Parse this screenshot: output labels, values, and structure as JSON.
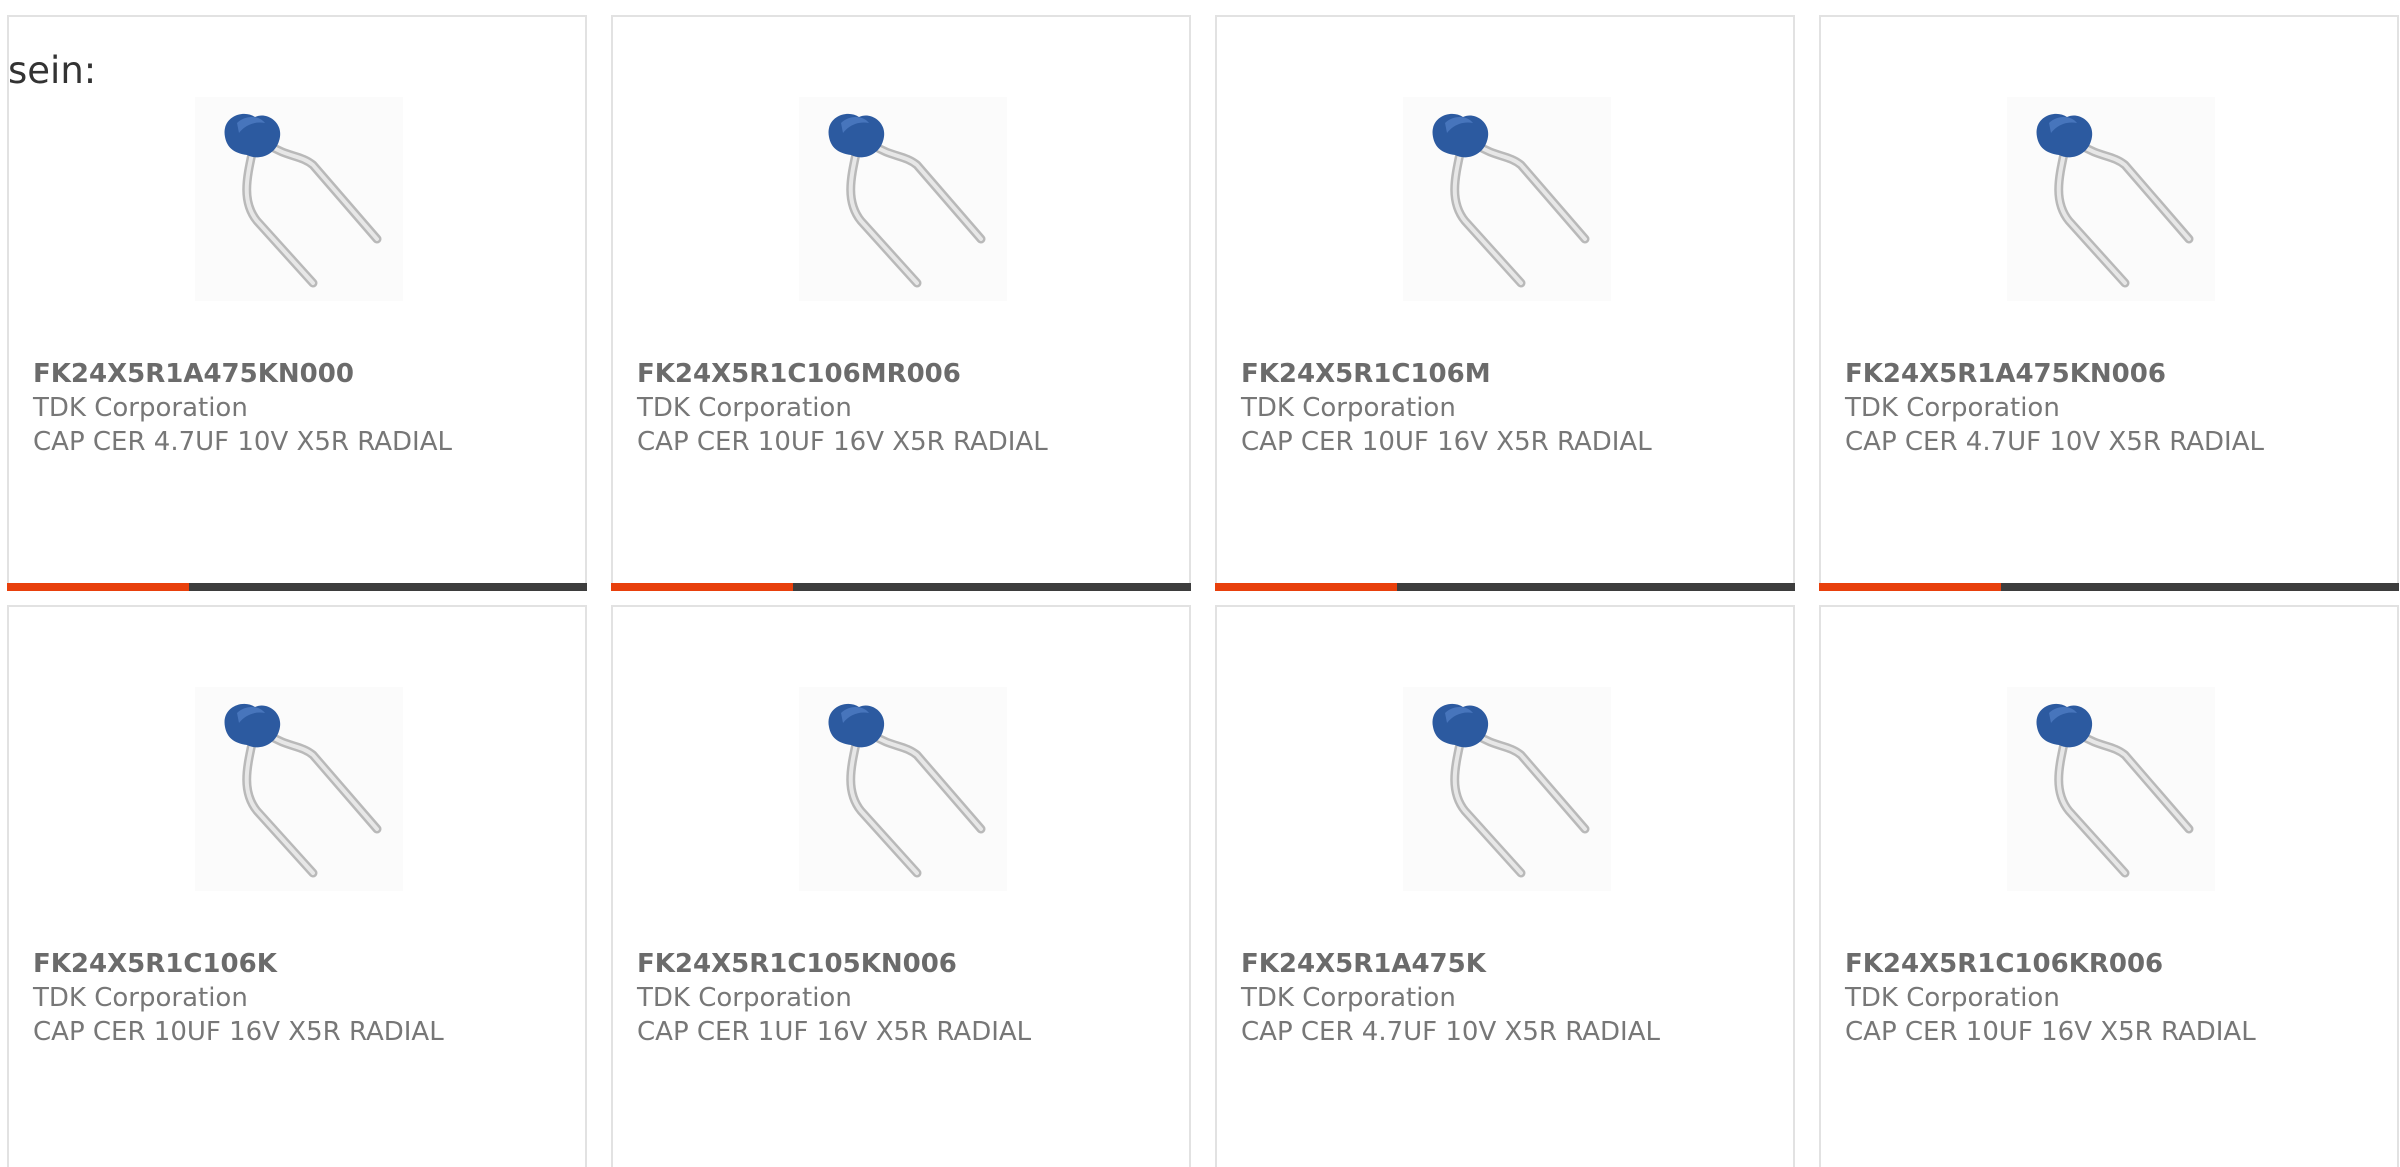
{
  "intro": {
    "text": "sein:"
  },
  "colors": {
    "accent": "#e8400c",
    "bar_dark": "#3d3d3d",
    "capacitor_blue": "#2c5aa0"
  },
  "products": [
    {
      "part_number": "FK24X5R1A475KN000",
      "manufacturer": "TDK Corporation",
      "description": "CAP CER 4.7UF 10V X5R RADIAL",
      "icon": "capacitor-image",
      "accent_bar": true
    },
    {
      "part_number": "FK24X5R1C106MR006",
      "manufacturer": "TDK Corporation",
      "description": "CAP CER 10UF 16V X5R RADIAL",
      "icon": "capacitor-image",
      "accent_bar": true
    },
    {
      "part_number": "FK24X5R1C106M",
      "manufacturer": "TDK Corporation",
      "description": "CAP CER 10UF 16V X5R RADIAL",
      "icon": "capacitor-image",
      "accent_bar": true
    },
    {
      "part_number": "FK24X5R1A475KN006",
      "manufacturer": "TDK Corporation",
      "description": "CAP CER 4.7UF 10V X5R RADIAL",
      "icon": "capacitor-image",
      "accent_bar": true
    },
    {
      "part_number": "FK24X5R1C106K",
      "manufacturer": "TDK Corporation",
      "description": "CAP CER 10UF 16V X5R RADIAL",
      "icon": "capacitor-image",
      "accent_bar": false
    },
    {
      "part_number": "FK24X5R1C105KN006",
      "manufacturer": "TDK Corporation",
      "description": "CAP CER 1UF 16V X5R RADIAL",
      "icon": "capacitor-image",
      "accent_bar": false
    },
    {
      "part_number": "FK24X5R1A475K",
      "manufacturer": "TDK Corporation",
      "description": "CAP CER 4.7UF 10V X5R RADIAL",
      "icon": "capacitor-image",
      "accent_bar": false
    },
    {
      "part_number": "FK24X5R1C106KR006",
      "manufacturer": "TDK Corporation",
      "description": "CAP CER 10UF 16V X5R RADIAL",
      "icon": "capacitor-image",
      "accent_bar": false
    }
  ]
}
